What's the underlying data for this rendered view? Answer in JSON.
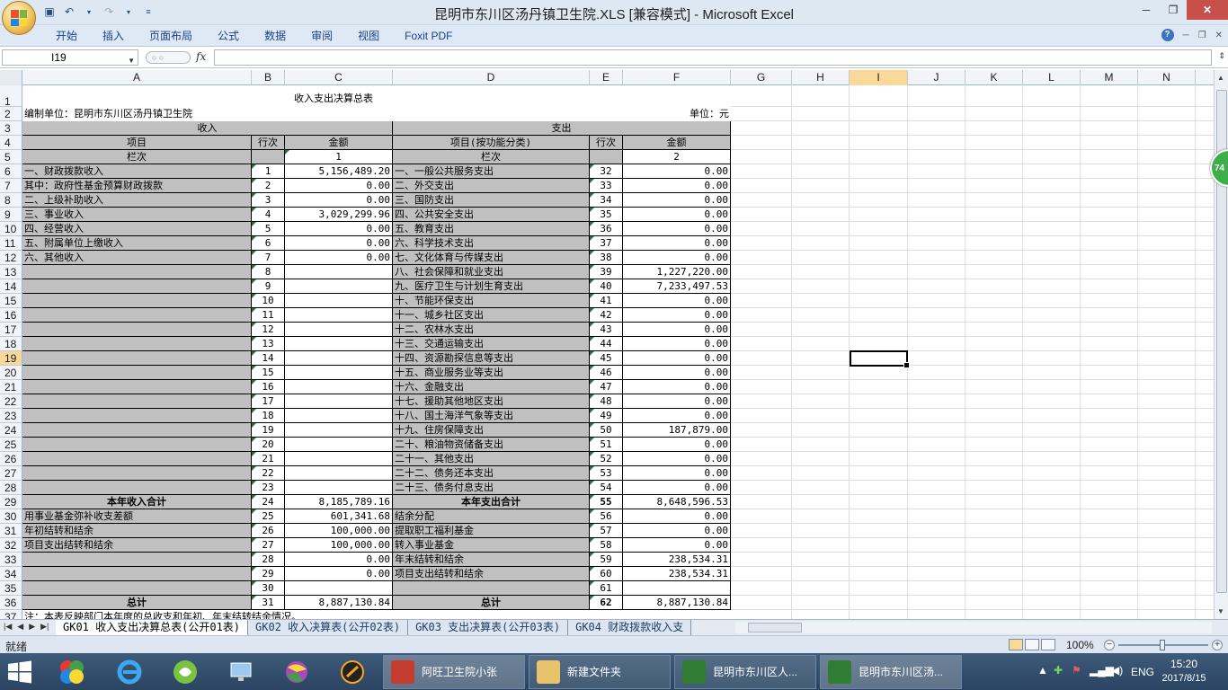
{
  "window": {
    "title": "昆明市东川区汤丹镇卫生院.XLS  [兼容模式] - Microsoft Excel",
    "controls": [
      "─",
      "❐",
      "✕"
    ]
  },
  "ribbon": {
    "tabs": [
      "开始",
      "插入",
      "页面布局",
      "公式",
      "数据",
      "审阅",
      "视图",
      "Foxit PDF"
    ]
  },
  "formula_bar": {
    "name_box": "I19",
    "fx": "fx",
    "formula": ""
  },
  "columns": [
    "A",
    "B",
    "C",
    "D",
    "E",
    "F",
    "G",
    "H",
    "I",
    "J",
    "K",
    "L",
    "M",
    "N"
  ],
  "rows": [
    "1",
    "2",
    "3",
    "4",
    "5",
    "6",
    "7",
    "8",
    "9",
    "10",
    "11",
    "12",
    "13",
    "14",
    "15",
    "16",
    "17",
    "18",
    "19",
    "20",
    "21",
    "22",
    "23",
    "24",
    "25",
    "26",
    "27",
    "28",
    "29",
    "30",
    "31",
    "32",
    "33",
    "34",
    "35",
    "36",
    "37"
  ],
  "sheet": {
    "title": "收入支出决算总表",
    "org": "编制单位：昆明市东川区汤丹镇卫生院",
    "unit": "单位：元",
    "income_header": "收入",
    "expense_header": "支出",
    "col_item": "项目",
    "col_row": "行次",
    "col_amount": "金额",
    "col_item_func": "项目(按功能分类)",
    "col_lanci": "栏次",
    "col_1": "1",
    "col_2": "2",
    "body": [
      {
        "a": "一、财政拨款收入",
        "b": "1",
        "c": "5,156,489.20",
        "d": "一、一般公共服务支出",
        "e": "32",
        "f": "0.00"
      },
      {
        "a": "    其中：政府性基金预算财政拨款",
        "b": "2",
        "c": "0.00",
        "d": "二、外交支出",
        "e": "33",
        "f": "0.00"
      },
      {
        "a": "二、上级补助收入",
        "b": "3",
        "c": "0.00",
        "d": "三、国防支出",
        "e": "34",
        "f": "0.00"
      },
      {
        "a": "三、事业收入",
        "b": "4",
        "c": "3,029,299.96",
        "d": "四、公共安全支出",
        "e": "35",
        "f": "0.00"
      },
      {
        "a": "四、经营收入",
        "b": "5",
        "c": "0.00",
        "d": "五、教育支出",
        "e": "36",
        "f": "0.00"
      },
      {
        "a": "五、附属单位上缴收入",
        "b": "6",
        "c": "0.00",
        "d": "六、科学技术支出",
        "e": "37",
        "f": "0.00"
      },
      {
        "a": "六、其他收入",
        "b": "7",
        "c": "0.00",
        "d": "七、文化体育与传媒支出",
        "e": "38",
        "f": "0.00"
      },
      {
        "a": "",
        "b": "8",
        "c": "",
        "d": "八、社会保障和就业支出",
        "e": "39",
        "f": "1,227,220.00"
      },
      {
        "a": "",
        "b": "9",
        "c": "",
        "d": "九、医疗卫生与计划生育支出",
        "e": "40",
        "f": "7,233,497.53"
      },
      {
        "a": "",
        "b": "10",
        "c": "",
        "d": "十、节能环保支出",
        "e": "41",
        "f": "0.00"
      },
      {
        "a": "",
        "b": "11",
        "c": "",
        "d": "十一、城乡社区支出",
        "e": "42",
        "f": "0.00"
      },
      {
        "a": "",
        "b": "12",
        "c": "",
        "d": "十二、农林水支出",
        "e": "43",
        "f": "0.00"
      },
      {
        "a": "",
        "b": "13",
        "c": "",
        "d": "十三、交通运输支出",
        "e": "44",
        "f": "0.00"
      },
      {
        "a": "",
        "b": "14",
        "c": "",
        "d": "十四、资源勘探信息等支出",
        "e": "45",
        "f": "0.00"
      },
      {
        "a": "",
        "b": "15",
        "c": "",
        "d": "十五、商业服务业等支出",
        "e": "46",
        "f": "0.00"
      },
      {
        "a": "",
        "b": "16",
        "c": "",
        "d": "十六、金融支出",
        "e": "47",
        "f": "0.00"
      },
      {
        "a": "",
        "b": "17",
        "c": "",
        "d": "十七、援助其他地区支出",
        "e": "48",
        "f": "0.00"
      },
      {
        "a": "",
        "b": "18",
        "c": "",
        "d": "十八、国土海洋气象等支出",
        "e": "49",
        "f": "0.00"
      },
      {
        "a": "",
        "b": "19",
        "c": "",
        "d": "十九、住房保障支出",
        "e": "50",
        "f": "187,879.00"
      },
      {
        "a": "",
        "b": "20",
        "c": "",
        "d": "二十、粮油物资储备支出",
        "e": "51",
        "f": "0.00"
      },
      {
        "a": "",
        "b": "21",
        "c": "",
        "d": "二十一、其他支出",
        "e": "52",
        "f": "0.00"
      },
      {
        "a": "",
        "b": "22",
        "c": "",
        "d": "二十二、债务还本支出",
        "e": "53",
        "f": "0.00"
      },
      {
        "a": "",
        "b": "23",
        "c": "",
        "d": "二十三、债务付息支出",
        "e": "54",
        "f": "0.00"
      },
      {
        "a": "本年收入合计",
        "b": "24",
        "c": "8,185,789.16",
        "d": "本年支出合计",
        "e": "55",
        "f": "8,648,596.53",
        "bold": true
      },
      {
        "a": "    用事业基金弥补收支差额",
        "b": "25",
        "c": "601,341.68",
        "d": "      结余分配",
        "e": "56",
        "f": "0.00"
      },
      {
        "a": "    年初结转和结余",
        "b": "26",
        "c": "100,000.00",
        "d": "        提取职工福利基金",
        "e": "57",
        "f": "0.00"
      },
      {
        "a": "      项目支出结转和结余",
        "b": "27",
        "c": "100,000.00",
        "d": "        转入事业基金",
        "e": "58",
        "f": "0.00"
      },
      {
        "a": "",
        "b": "28",
        "c": "0.00",
        "d": "      年末结转和结余",
        "e": "59",
        "f": "238,534.31"
      },
      {
        "a": "",
        "b": "29",
        "c": "0.00",
        "d": "        项目支出结转和结余",
        "e": "60",
        "f": "238,534.31"
      },
      {
        "a": "",
        "b": "30",
        "c": "",
        "d": "",
        "e": "61",
        "f": ""
      },
      {
        "a": "总计",
        "b": "31",
        "c": "8,887,130.84",
        "d": "总计",
        "e": "62",
        "f": "8,887,130.84",
        "bold": true
      }
    ],
    "note": "注：本表反映部门本年度的总收支和年初、年末结转结余情况。"
  },
  "sheet_tabs": [
    "GK01 收入支出决算总表(公开01表)",
    "GK02 收入决算表(公开02表)",
    "GK03 支出决算表(公开03表)",
    "GK04 财政拨款收入支"
  ],
  "status": {
    "ready": "就绪",
    "zoom": "100%"
  },
  "badge": "74",
  "taskbar": {
    "tasks": [
      "阿旺卫生院小张",
      "新建文件夹",
      "昆明市东川区人...",
      "昆明市东川区汤..."
    ],
    "lang": "ENG",
    "time": "15:20",
    "date": "2017/8/15"
  }
}
